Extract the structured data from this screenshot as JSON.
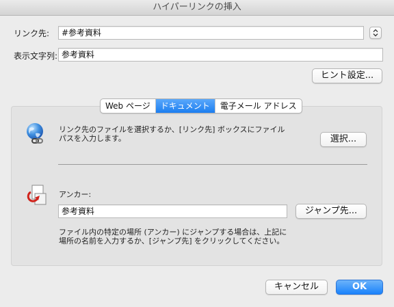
{
  "window": {
    "title": "ハイパーリンクの挿入"
  },
  "link": {
    "label": "リンク先:",
    "value": "#参考資料"
  },
  "display": {
    "label": "表示文字列:",
    "value": "参考資料"
  },
  "hint_button": "ヒント設定...",
  "tabs": [
    {
      "label": "Web ページ",
      "selected": false
    },
    {
      "label": "ドキュメント",
      "selected": true
    },
    {
      "label": "電子メール アドレス",
      "selected": false
    }
  ],
  "document": {
    "description_line1": "リンク先のファイルを選択するか、[リンク先] ボックスにファイル",
    "description_line2": "パスを入力します。",
    "select_button": "選択..."
  },
  "anchor": {
    "label": "アンカー:",
    "value": "参考資料",
    "jump_button": "ジャンプ先...",
    "help_line1": "ファイル内の特定の場所 (アンカー) にジャンプする場合は、上記に",
    "help_line2": "場所の名前を入力するか、[ジャンプ先] をクリックしてください。"
  },
  "footer": {
    "cancel": "キャンセル",
    "ok": "OK"
  },
  "colors": {
    "accent": "#1a82fb",
    "window_bg": "#ececec",
    "group_bg": "#e3e3e3"
  },
  "icons": {
    "stepper": "up-down-chevron-icon",
    "document": "globe-link-icon",
    "anchor": "anchor-document-icon"
  }
}
